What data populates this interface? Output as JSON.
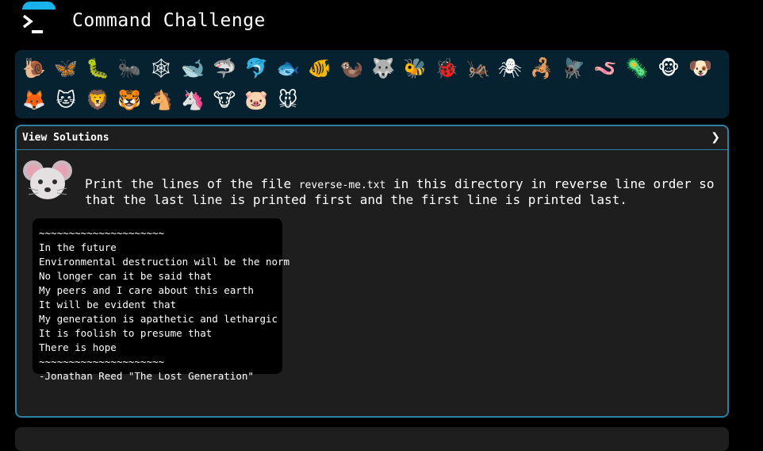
{
  "header": {
    "title": "Command Challenge"
  },
  "animals": {
    "row1": [
      {
        "name": "snail-icon",
        "glyph": "🐌"
      },
      {
        "name": "butterfly-icon",
        "glyph": "🦋"
      },
      {
        "name": "caterpillar-icon",
        "glyph": "🐛"
      },
      {
        "name": "ant-icon",
        "glyph": "🐜"
      },
      {
        "name": "spider-web-icon",
        "glyph": "🕸"
      },
      {
        "name": "whale-icon",
        "glyph": "🐋"
      },
      {
        "name": "shark-icon",
        "glyph": "🦈"
      },
      {
        "name": "dolphin-icon",
        "glyph": "🐬"
      },
      {
        "name": "fish-icon",
        "glyph": "🐟"
      },
      {
        "name": "tropical-fish-icon",
        "glyph": "🐠"
      },
      {
        "name": "otter-icon",
        "glyph": "🦦"
      },
      {
        "name": "wolf-icon",
        "glyph": "🐺"
      },
      {
        "name": "bee-icon",
        "glyph": "🐝"
      },
      {
        "name": "ladybug-icon",
        "glyph": "🐞"
      },
      {
        "name": "cricket-icon",
        "glyph": "🦗"
      },
      {
        "name": "spider-icon",
        "glyph": "🕷"
      },
      {
        "name": "scorpion-icon",
        "glyph": "🦂"
      },
      {
        "name": "fly-icon",
        "glyph": "🪰"
      },
      {
        "name": "worm-icon",
        "glyph": "🪱"
      },
      {
        "name": "microbe-icon",
        "glyph": "🦠"
      },
      {
        "name": "monkey-icon",
        "glyph": "🐵"
      },
      {
        "name": "dog-icon",
        "glyph": "🐶"
      }
    ],
    "row2": [
      {
        "name": "fox-icon",
        "glyph": "🦊"
      },
      {
        "name": "cat-icon",
        "glyph": "🐱"
      },
      {
        "name": "lion-icon",
        "glyph": "🦁"
      },
      {
        "name": "tiger-icon",
        "glyph": "🐯"
      },
      {
        "name": "horse-icon",
        "glyph": "🐴"
      },
      {
        "name": "unicorn-icon",
        "glyph": "🦄"
      },
      {
        "name": "cow-icon",
        "glyph": "🐮"
      },
      {
        "name": "pig-icon",
        "glyph": "🐷"
      },
      {
        "name": "mouse-icon",
        "glyph": "🐭"
      }
    ]
  },
  "panel": {
    "view_solutions": "View Solutions",
    "task_before": "Print the lines of the file ",
    "task_file": "reverse-me.txt",
    "task_after": " in this directory in reverse line order so that the last line is printed first and the first line is printed last.",
    "poem_lines": [
      "~~~~~~~~~~~~~~~~~~~~~",
      "In the future",
      "Environmental destruction will be the norm",
      "No longer can it be said that",
      "My peers and I care about this earth",
      "It will be evident that",
      "My generation is apathetic and lethargic",
      "It is foolish to presume that",
      "There is hope",
      "~~~~~~~~~~~~~~~~~~~~~",
      "-Jonathan Reed \"The Lost Generation\""
    ]
  },
  "colors": {
    "accent": "#19b3ec",
    "panel_border": "#2a80a6",
    "animal_bar_bg": "#062130",
    "panel_bg": "#1e1e1e"
  }
}
